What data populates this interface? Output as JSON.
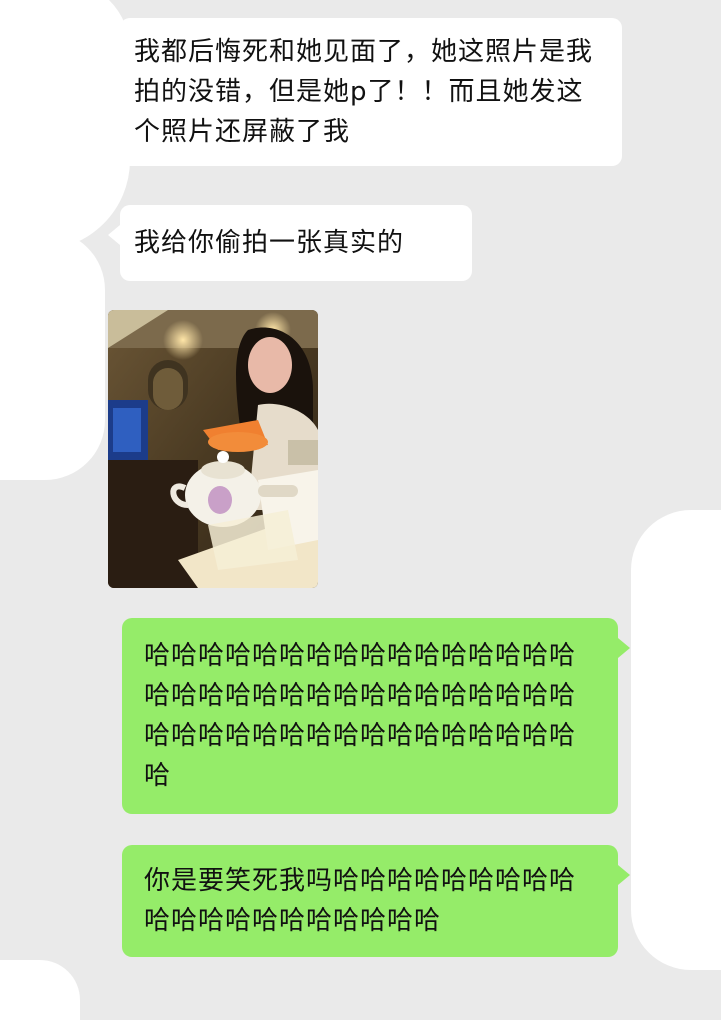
{
  "messages": [
    {
      "side": "received",
      "text": "我都后悔死和她见面了，她这照片是我拍的没错，但是她p了！！而且她发这个照片还屏蔽了我"
    },
    {
      "side": "received",
      "text": "我给你偷拍一张真实的"
    },
    {
      "side": "received",
      "type": "image"
    },
    {
      "side": "sent",
      "text": "哈哈哈哈哈哈哈哈哈哈哈哈哈哈哈哈哈哈哈哈哈哈哈哈哈哈哈哈哈哈哈哈哈哈哈哈哈哈哈哈哈哈哈哈哈哈哈哈哈"
    },
    {
      "side": "sent",
      "text": "你是要笑死我吗哈哈哈哈哈哈哈哈哈哈哈哈哈哈哈哈哈哈哈哈"
    }
  ],
  "colors": {
    "background": "#eaeaea",
    "received_bubble": "#ffffff",
    "sent_bubble": "#95ec69"
  }
}
